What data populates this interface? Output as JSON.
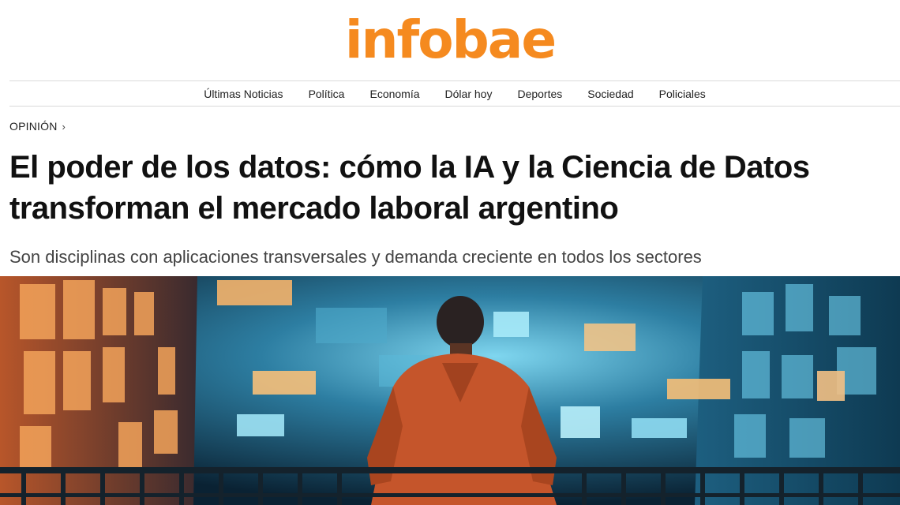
{
  "brand": {
    "logo_text": "infobae",
    "accent": "#f58a1f"
  },
  "nav": {
    "items": [
      {
        "label": "Últimas Noticias"
      },
      {
        "label": "Política"
      },
      {
        "label": "Economía"
      },
      {
        "label": "Dólar hoy"
      },
      {
        "label": "Deportes"
      },
      {
        "label": "Sociedad"
      },
      {
        "label": "Policiales"
      }
    ]
  },
  "article": {
    "section": "OPINIÓN",
    "section_icon": "chevron-right-icon",
    "title": "El poder de los datos: cómo la IA y la Ciencia de Datos transforman el mercado laboral argentino",
    "subtitle": "Son disciplinas con aplicaciones transversales y demanda creciente en todos los sectores"
  },
  "hero_image": {
    "palette": {
      "sky": "#0b2a3d",
      "glow": "#55c6e8",
      "warm": "#f0893a",
      "figure": "#c5552b"
    }
  }
}
